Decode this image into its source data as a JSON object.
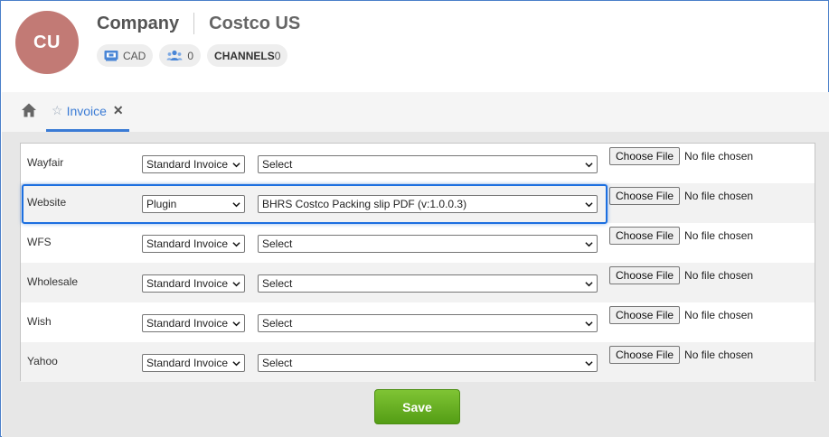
{
  "header": {
    "avatar_initials": "CU",
    "avatar_color": "#c27a75",
    "title": "Company",
    "company_name": "Costco US",
    "badges": {
      "currency": "CAD",
      "users_count": "0",
      "channels_label": "CHANNELS",
      "channels_count": "0"
    }
  },
  "tabs": {
    "active_tab": "Invoice"
  },
  "rows": [
    {
      "channel": "Wayfair",
      "type": "Standard Invoice",
      "template": "Select",
      "file_button": "Choose File",
      "file_status": "No file chosen"
    },
    {
      "channel": "Website",
      "type": "Plugin",
      "template": "BHRS Costco Packing slip PDF (v:1.0.0.3)",
      "file_button": "Choose File",
      "file_status": "No file chosen"
    },
    {
      "channel": "WFS",
      "type": "Standard Invoice",
      "template": "Select",
      "file_button": "Choose File",
      "file_status": "No file chosen"
    },
    {
      "channel": "Wholesale",
      "type": "Standard Invoice",
      "template": "Select",
      "file_button": "Choose File",
      "file_status": "No file chosen"
    },
    {
      "channel": "Wish",
      "type": "Standard Invoice",
      "template": "Select",
      "file_button": "Choose File",
      "file_status": "No file chosen"
    },
    {
      "channel": "Yahoo",
      "type": "Standard Invoice",
      "template": "Select",
      "file_button": "Choose File",
      "file_status": "No file chosen"
    }
  ],
  "actions": {
    "save_label": "Save",
    "save_color": "#63ad1f"
  },
  "colors": {
    "accent": "#3a7bd5",
    "highlight": "#1c6fe0"
  }
}
